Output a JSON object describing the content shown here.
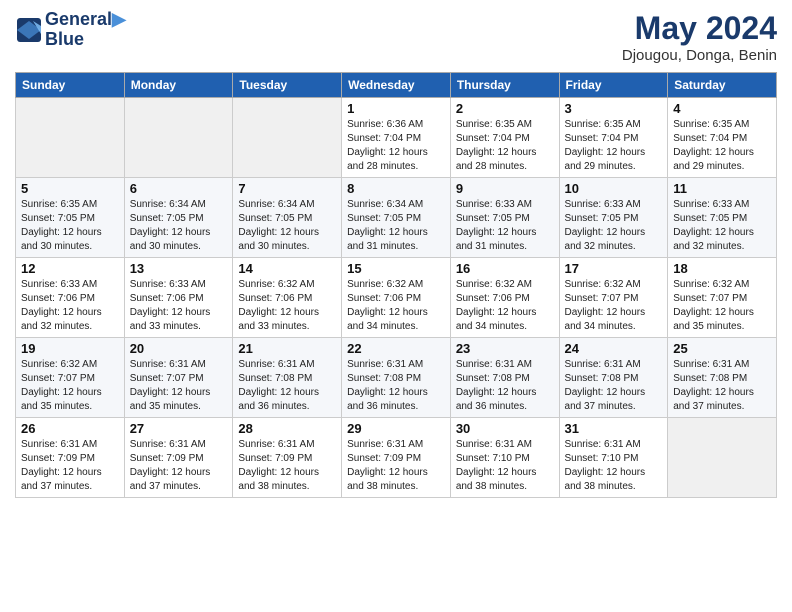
{
  "header": {
    "logo_line1": "General",
    "logo_line2": "Blue",
    "month": "May 2024",
    "location": "Djougou, Donga, Benin"
  },
  "weekdays": [
    "Sunday",
    "Monday",
    "Tuesday",
    "Wednesday",
    "Thursday",
    "Friday",
    "Saturday"
  ],
  "weeks": [
    [
      {
        "day": "",
        "info": ""
      },
      {
        "day": "",
        "info": ""
      },
      {
        "day": "",
        "info": ""
      },
      {
        "day": "1",
        "info": "Sunrise: 6:36 AM\nSunset: 7:04 PM\nDaylight: 12 hours\nand 28 minutes."
      },
      {
        "day": "2",
        "info": "Sunrise: 6:35 AM\nSunset: 7:04 PM\nDaylight: 12 hours\nand 28 minutes."
      },
      {
        "day": "3",
        "info": "Sunrise: 6:35 AM\nSunset: 7:04 PM\nDaylight: 12 hours\nand 29 minutes."
      },
      {
        "day": "4",
        "info": "Sunrise: 6:35 AM\nSunset: 7:04 PM\nDaylight: 12 hours\nand 29 minutes."
      }
    ],
    [
      {
        "day": "5",
        "info": "Sunrise: 6:35 AM\nSunset: 7:05 PM\nDaylight: 12 hours\nand 30 minutes."
      },
      {
        "day": "6",
        "info": "Sunrise: 6:34 AM\nSunset: 7:05 PM\nDaylight: 12 hours\nand 30 minutes."
      },
      {
        "day": "7",
        "info": "Sunrise: 6:34 AM\nSunset: 7:05 PM\nDaylight: 12 hours\nand 30 minutes."
      },
      {
        "day": "8",
        "info": "Sunrise: 6:34 AM\nSunset: 7:05 PM\nDaylight: 12 hours\nand 31 minutes."
      },
      {
        "day": "9",
        "info": "Sunrise: 6:33 AM\nSunset: 7:05 PM\nDaylight: 12 hours\nand 31 minutes."
      },
      {
        "day": "10",
        "info": "Sunrise: 6:33 AM\nSunset: 7:05 PM\nDaylight: 12 hours\nand 32 minutes."
      },
      {
        "day": "11",
        "info": "Sunrise: 6:33 AM\nSunset: 7:05 PM\nDaylight: 12 hours\nand 32 minutes."
      }
    ],
    [
      {
        "day": "12",
        "info": "Sunrise: 6:33 AM\nSunset: 7:06 PM\nDaylight: 12 hours\nand 32 minutes."
      },
      {
        "day": "13",
        "info": "Sunrise: 6:33 AM\nSunset: 7:06 PM\nDaylight: 12 hours\nand 33 minutes."
      },
      {
        "day": "14",
        "info": "Sunrise: 6:32 AM\nSunset: 7:06 PM\nDaylight: 12 hours\nand 33 minutes."
      },
      {
        "day": "15",
        "info": "Sunrise: 6:32 AM\nSunset: 7:06 PM\nDaylight: 12 hours\nand 34 minutes."
      },
      {
        "day": "16",
        "info": "Sunrise: 6:32 AM\nSunset: 7:06 PM\nDaylight: 12 hours\nand 34 minutes."
      },
      {
        "day": "17",
        "info": "Sunrise: 6:32 AM\nSunset: 7:07 PM\nDaylight: 12 hours\nand 34 minutes."
      },
      {
        "day": "18",
        "info": "Sunrise: 6:32 AM\nSunset: 7:07 PM\nDaylight: 12 hours\nand 35 minutes."
      }
    ],
    [
      {
        "day": "19",
        "info": "Sunrise: 6:32 AM\nSunset: 7:07 PM\nDaylight: 12 hours\nand 35 minutes."
      },
      {
        "day": "20",
        "info": "Sunrise: 6:31 AM\nSunset: 7:07 PM\nDaylight: 12 hours\nand 35 minutes."
      },
      {
        "day": "21",
        "info": "Sunrise: 6:31 AM\nSunset: 7:08 PM\nDaylight: 12 hours\nand 36 minutes."
      },
      {
        "day": "22",
        "info": "Sunrise: 6:31 AM\nSunset: 7:08 PM\nDaylight: 12 hours\nand 36 minutes."
      },
      {
        "day": "23",
        "info": "Sunrise: 6:31 AM\nSunset: 7:08 PM\nDaylight: 12 hours\nand 36 minutes."
      },
      {
        "day": "24",
        "info": "Sunrise: 6:31 AM\nSunset: 7:08 PM\nDaylight: 12 hours\nand 37 minutes."
      },
      {
        "day": "25",
        "info": "Sunrise: 6:31 AM\nSunset: 7:08 PM\nDaylight: 12 hours\nand 37 minutes."
      }
    ],
    [
      {
        "day": "26",
        "info": "Sunrise: 6:31 AM\nSunset: 7:09 PM\nDaylight: 12 hours\nand 37 minutes."
      },
      {
        "day": "27",
        "info": "Sunrise: 6:31 AM\nSunset: 7:09 PM\nDaylight: 12 hours\nand 37 minutes."
      },
      {
        "day": "28",
        "info": "Sunrise: 6:31 AM\nSunset: 7:09 PM\nDaylight: 12 hours\nand 38 minutes."
      },
      {
        "day": "29",
        "info": "Sunrise: 6:31 AM\nSunset: 7:09 PM\nDaylight: 12 hours\nand 38 minutes."
      },
      {
        "day": "30",
        "info": "Sunrise: 6:31 AM\nSunset: 7:10 PM\nDaylight: 12 hours\nand 38 minutes."
      },
      {
        "day": "31",
        "info": "Sunrise: 6:31 AM\nSunset: 7:10 PM\nDaylight: 12 hours\nand 38 minutes."
      },
      {
        "day": "",
        "info": ""
      }
    ]
  ]
}
